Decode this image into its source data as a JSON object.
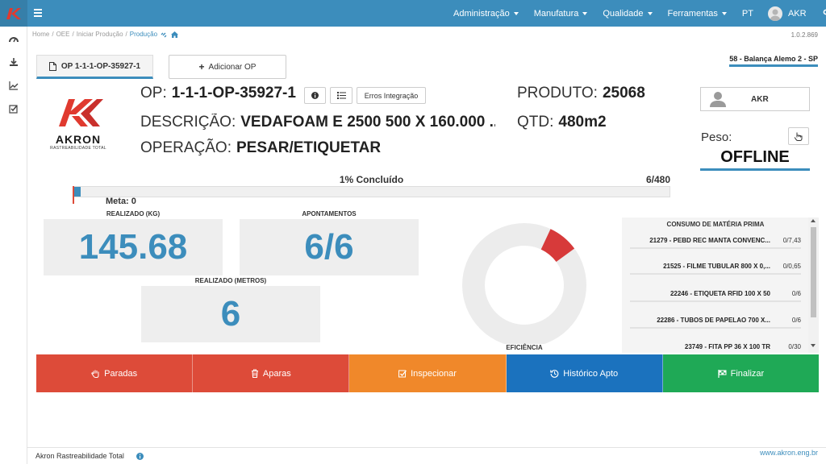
{
  "topbar": {
    "menus": [
      "Administração",
      "Manufatura",
      "Qualidade",
      "Ferramentas"
    ],
    "language": "PT",
    "user": "AKR"
  },
  "breadcrumb": [
    "Home",
    "OEE",
    "Iniciar Produção",
    "Produção"
  ],
  "version": "1.0.2.869",
  "tabs": {
    "active": "OP 1-1-1-OP-35927-1",
    "add": "Adicionar OP"
  },
  "station": "58 - Balança Alemo 2 - SP",
  "brand": {
    "name": "AKRON",
    "tagline": "RASTREABILIDADE TOTAL"
  },
  "op": {
    "op_label": "OP:",
    "op_value": "1-1-1-OP-35927-1",
    "erros_button": "Erros Integração",
    "descricao_label": "DESCRIÇÃO:",
    "descricao_value": "VEDAFOAM E 2500 500 X 160.000 ...",
    "operacao_label": "OPERAÇÃO:",
    "operacao_value": "PESAR/ETIQUETAR",
    "produto_label": "PRODUTO:",
    "produto_value": "25068",
    "qtd_label": "QTD:",
    "qtd_value": "480m2"
  },
  "operator": {
    "name": "AKR"
  },
  "peso": {
    "label": "Peso:",
    "status": "OFFLINE"
  },
  "progress": {
    "label": "1% Concluído",
    "count": "6/480",
    "fraction": 0.0125,
    "meta": "Meta: 0"
  },
  "kpis": {
    "realizado_kg_label": "REALIZADO (KG)",
    "realizado_kg": "145.68",
    "apontamentos_label": "APONTAMENTOS",
    "apontamentos": "6/6",
    "realizado_m_label": "REALIZADO (METROS)",
    "realizado_m": "6"
  },
  "eficiencia": {
    "label": "EFICIÊNCIA",
    "fraction": 0.08
  },
  "consumo": {
    "title": "CONSUMO DE MATÉRIA PRIMA",
    "rows": [
      {
        "name": "21279 - PEBD REC MANTA CONVENC...",
        "qty": "0/7,43"
      },
      {
        "name": "21525 - FILME TUBULAR 800 X 0,...",
        "qty": "0/0,65"
      },
      {
        "name": "22246 - ETIQUETA RFID 100 X 50",
        "qty": "0/6"
      },
      {
        "name": "22286 - TUBOS DE PAPELAO 700 X...",
        "qty": "0/6"
      },
      {
        "name": "23749 - FITA PP 36 X 100 TR",
        "qty": "0/30"
      }
    ]
  },
  "actions": [
    {
      "label": "Paradas",
      "color": "#dd4b39"
    },
    {
      "label": "Aparas",
      "color": "#dd4b39"
    },
    {
      "label": "Inspecionar",
      "color": "#f0882a"
    },
    {
      "label": "Histórico Apto",
      "color": "#1b72be"
    },
    {
      "label": "Finalizar",
      "color": "#1fa956"
    }
  ],
  "footer": {
    "left": "Akron Rastreabilidade Total",
    "right": "www.akron.eng.br"
  }
}
